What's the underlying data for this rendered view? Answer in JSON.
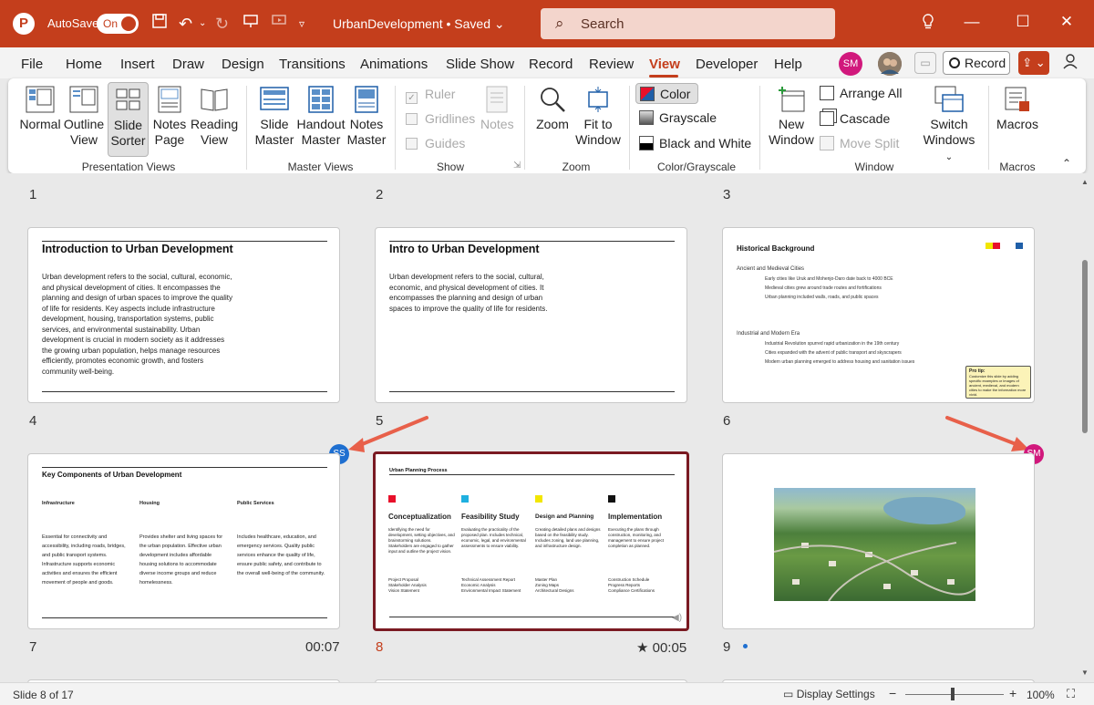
{
  "titlebar": {
    "autosave_label": "AutoSave",
    "autosave_state": "On",
    "doc_title": "UrbanDevelopment • Saved",
    "search_placeholder": "Search"
  },
  "menu": [
    "File",
    "Home",
    "Insert",
    "Draw",
    "Design",
    "Transitions",
    "Animations",
    "Slide Show",
    "Record",
    "Review",
    "View",
    "Developer",
    "Help"
  ],
  "menu_active": "View",
  "collab": {
    "avatar_initials": "SM",
    "record_label": "Record"
  },
  "ribbon": {
    "presentation_views": {
      "normal": "Normal",
      "outline_view": "Outline View",
      "slide_sorter": "Slide Sorter",
      "notes_page": "Notes Page",
      "reading_view": "Reading View",
      "label": "Presentation Views"
    },
    "master_views": {
      "slide_master": "Slide Master",
      "handout_master": "Handout Master",
      "notes_master": "Notes Master",
      "label": "Master Views"
    },
    "show": {
      "ruler": "Ruler",
      "gridlines": "Gridlines",
      "guides": "Guides",
      "notes": "Notes",
      "label": "Show"
    },
    "zoom": {
      "zoom": "Zoom",
      "fit_to_window": "Fit to Window",
      "label": "Zoom"
    },
    "color": {
      "color": "Color",
      "grayscale": "Grayscale",
      "bw": "Black and White",
      "label": "Color/Grayscale"
    },
    "window": {
      "new_window": "New Window",
      "arrange_all": "Arrange All",
      "cascade": "Cascade",
      "move_split": "Move Split",
      "switch_windows": "Switch Windows",
      "label": "Window"
    },
    "macros": {
      "macros": "Macros",
      "label": "Macros"
    }
  },
  "row_top_numbers": [
    "1",
    "2",
    "3"
  ],
  "slides": {
    "s4": {
      "num": "4",
      "title": "Introduction to Urban Development",
      "body": "Urban development refers to the social, cultural, economic, and physical development of cities. It encompasses the planning and design of urban spaces to improve the quality of life for residents. Key aspects include infrastructure development, housing, transportation systems, public services, and environmental sustainability. Urban development is crucial in modern society as it addresses the growing urban population, helps manage resources efficiently, promotes economic growth, and fosters community well-being."
    },
    "s5": {
      "num": "5",
      "title": "Intro to Urban Development",
      "body": "Urban development refers to the social, cultural, economic, and physical development of cities. It encompasses the planning and design of urban spaces to improve the quality of life for residents."
    },
    "s6": {
      "num": "6",
      "title": "Historical Background",
      "sec1": "Ancient and Medieval Cities",
      "sec1_items": [
        "Early cities like Uruk and Mohenjo-Daro date back to 4000 BCE",
        "Medieval cities grew around trade routes and fortifications",
        "Urban planning included walls, roads, and public spaces"
      ],
      "sec2": "Industrial and Modern Era",
      "sec2_items": [
        "Industrial Revolution spurred rapid urbanization in the 19th century",
        "Cities expanded with the advent of public transport and skyscrapers",
        "Modern urban planning emerged to address housing and sanitation issues"
      ],
      "tip_title": "Pro tip:",
      "tip_body": "Customize this slide by adding specific examples or images of ancient, medieval, and modern cities to make the information more vivid."
    },
    "s7": {
      "num": "7",
      "title": "Key Components of Urban Development",
      "duration": "00:07",
      "cols": [
        {
          "head": "Infrastructure",
          "text": "Essential for connectivity and accessibility, including roads, bridges, and public transport systems. Infrastructure supports economic activities and ensures the efficient movement of people and goods."
        },
        {
          "head": "Housing",
          "text": "Provides shelter and living spaces for the urban population. Effective urban development includes affordable housing solutions to accommodate diverse income groups and reduce homelessness."
        },
        {
          "head": "Public Services",
          "text": "Includes healthcare, education, and emergency services. Quality public services enhance the quality of life, ensure public safety, and contribute to the overall well-being of the community."
        }
      ]
    },
    "s8": {
      "num": "8",
      "title": "Urban Planning Process",
      "duration": "00:05",
      "star": "★",
      "cols": [
        {
          "color": "#e8102a",
          "head": "Conceptualization",
          "text": "Identifying the need for development, setting objectives, and brainstorming solutions. Stakeholders are engaged to gather input and outline the project vision.",
          "items": "Project Proposal\nStakeholder Analysis\nVision Statement"
        },
        {
          "color": "#1fb0e0",
          "head": "Feasibility Study",
          "text": "Evaluating the practicality of the proposed plan. Includes technical, economic, legal, and environmental assessments to ensure viability.",
          "items": "Technical Assessment Report\nEconomic Analysis\nEnvironmental Impact Statement"
        },
        {
          "color": "#f2e600",
          "head": "Design and Planning",
          "text": "Creating detailed plans and designs based on the feasibility study. Includes zoning, land use planning, and infrastructure design.",
          "items": "Master Plan\nZoning Maps\nArchitectural Designs"
        },
        {
          "color": "#111111",
          "head": "Implementation",
          "text": "Executing the plans through construction, monitoring, and management to ensure project completion as planned.",
          "items": "Construction Schedule\nProgress Reports\nCompliance Certifications"
        }
      ]
    },
    "s9": {
      "num": "9"
    }
  },
  "badges": {
    "ss": "SS",
    "sm": "SM"
  },
  "status": {
    "slide_of": "Slide 8 of 17",
    "display_settings": "Display Settings",
    "zoom_minus": "−",
    "zoom_plus": "+",
    "zoom_level": "100%"
  },
  "colors": {
    "accent": "#c43e1c",
    "selected_border": "#7a1a22"
  }
}
